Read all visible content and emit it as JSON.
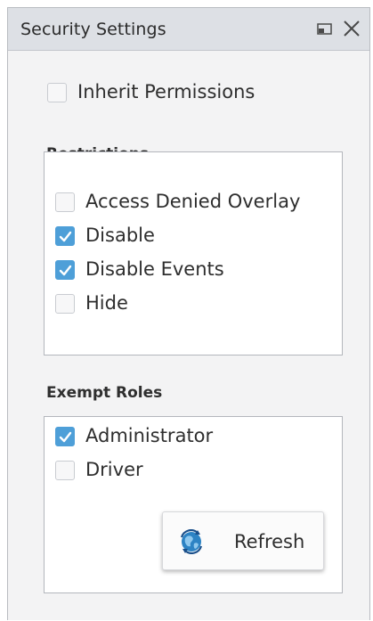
{
  "window": {
    "title": "Security Settings",
    "restore_icon": "restore-window-icon",
    "close_icon": "close-icon"
  },
  "inherit": {
    "label": "Inherit Permissions",
    "checked": false
  },
  "restrictions": {
    "title": "Restrictions",
    "items": [
      {
        "label": "Access Denied Overlay",
        "checked": false
      },
      {
        "label": "Disable",
        "checked": true
      },
      {
        "label": "Disable Events",
        "checked": true
      },
      {
        "label": "Hide",
        "checked": false
      }
    ]
  },
  "exempt_roles": {
    "title": "Exempt Roles",
    "items": [
      {
        "label": "Administrator",
        "checked": true
      },
      {
        "label": "Driver",
        "checked": false
      }
    ]
  },
  "refresh_button": {
    "label": "Refresh",
    "icon": "refresh-globe-icon"
  },
  "colors": {
    "accent": "#4e9fd8",
    "titlebar": "#dde0e5",
    "panel_bg": "#f3f3f4"
  }
}
